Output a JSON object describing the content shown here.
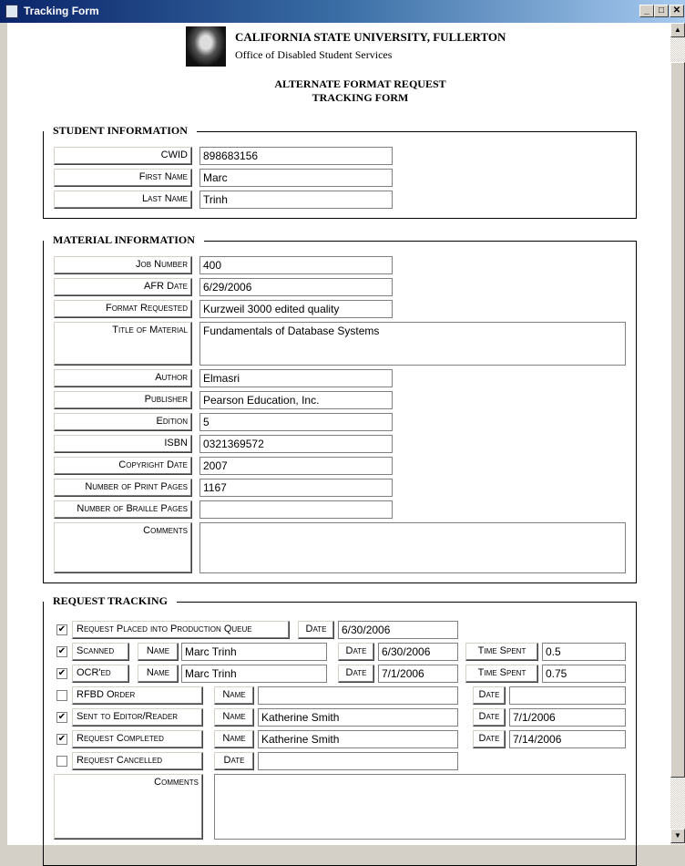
{
  "window": {
    "title": "Tracking Form",
    "minimize": "_",
    "maximize": "□",
    "close": "✕"
  },
  "header": {
    "university": "CALIFORNIA STATE UNIVERSITY, FULLERTON",
    "office": "Office of Disabled Student Services",
    "title1": "ALTERNATE FORMAT REQUEST",
    "title2": "TRACKING FORM"
  },
  "student": {
    "legend": "STUDENT INFORMATION",
    "fields": [
      {
        "label": "CWID",
        "value": "898683156"
      },
      {
        "label": "First Name",
        "value": "Marc"
      },
      {
        "label": "Last Name",
        "value": "Trinh"
      }
    ]
  },
  "material": {
    "legend": "MATERIAL INFORMATION",
    "fields": [
      {
        "label": "Job Number",
        "value": "400"
      },
      {
        "label": "AFR Date",
        "value": "6/29/2006"
      },
      {
        "label": "Format Requested",
        "value": "Kurzweil 3000 edited quality"
      },
      {
        "label": "Title of Material",
        "value": "Fundamentals of Database Systems"
      },
      {
        "label": "Author",
        "value": "Elmasri"
      },
      {
        "label": "Publisher",
        "value": "Pearson Education, Inc."
      },
      {
        "label": "Edition",
        "value": "5"
      },
      {
        "label": "ISBN",
        "value": "0321369572"
      },
      {
        "label": "Copyright Date",
        "value": "2007"
      },
      {
        "label": "Number of Print Pages",
        "value": "1167"
      },
      {
        "label": "Number of Braille Pages",
        "value": ""
      },
      {
        "label": "Comments",
        "value": ""
      }
    ]
  },
  "tracking": {
    "legend": "REQUEST TRACKING",
    "name_label": "Name",
    "date_label": "Date",
    "time_label": "Time Spent",
    "comments_label": "Comments",
    "comments_value": "",
    "rows": [
      {
        "label": "Request Placed into Production Queue",
        "checked": true,
        "date": "6/30/2006"
      },
      {
        "label": "Scanned",
        "checked": true,
        "name": "Marc Trinh",
        "date": "6/30/2006",
        "time": "0.5"
      },
      {
        "label": "OCR'ed",
        "checked": true,
        "name": "Marc Trinh",
        "date": "7/1/2006",
        "time": "0.75"
      },
      {
        "label": "RFBD Order",
        "checked": false,
        "name": "",
        "date": ""
      },
      {
        "label": "Sent to Editor/Reader",
        "checked": true,
        "name": "Katherine Smith",
        "date": "7/1/2006"
      },
      {
        "label": "Request Completed",
        "checked": true,
        "name": "Katherine Smith",
        "date": "7/14/2006"
      },
      {
        "label": "Request Cancelled",
        "checked": false,
        "date": ""
      }
    ]
  },
  "icons": {
    "logo": "elephant-logo",
    "check": "✔",
    "scroll_up": "▲",
    "scroll_down": "▼"
  }
}
